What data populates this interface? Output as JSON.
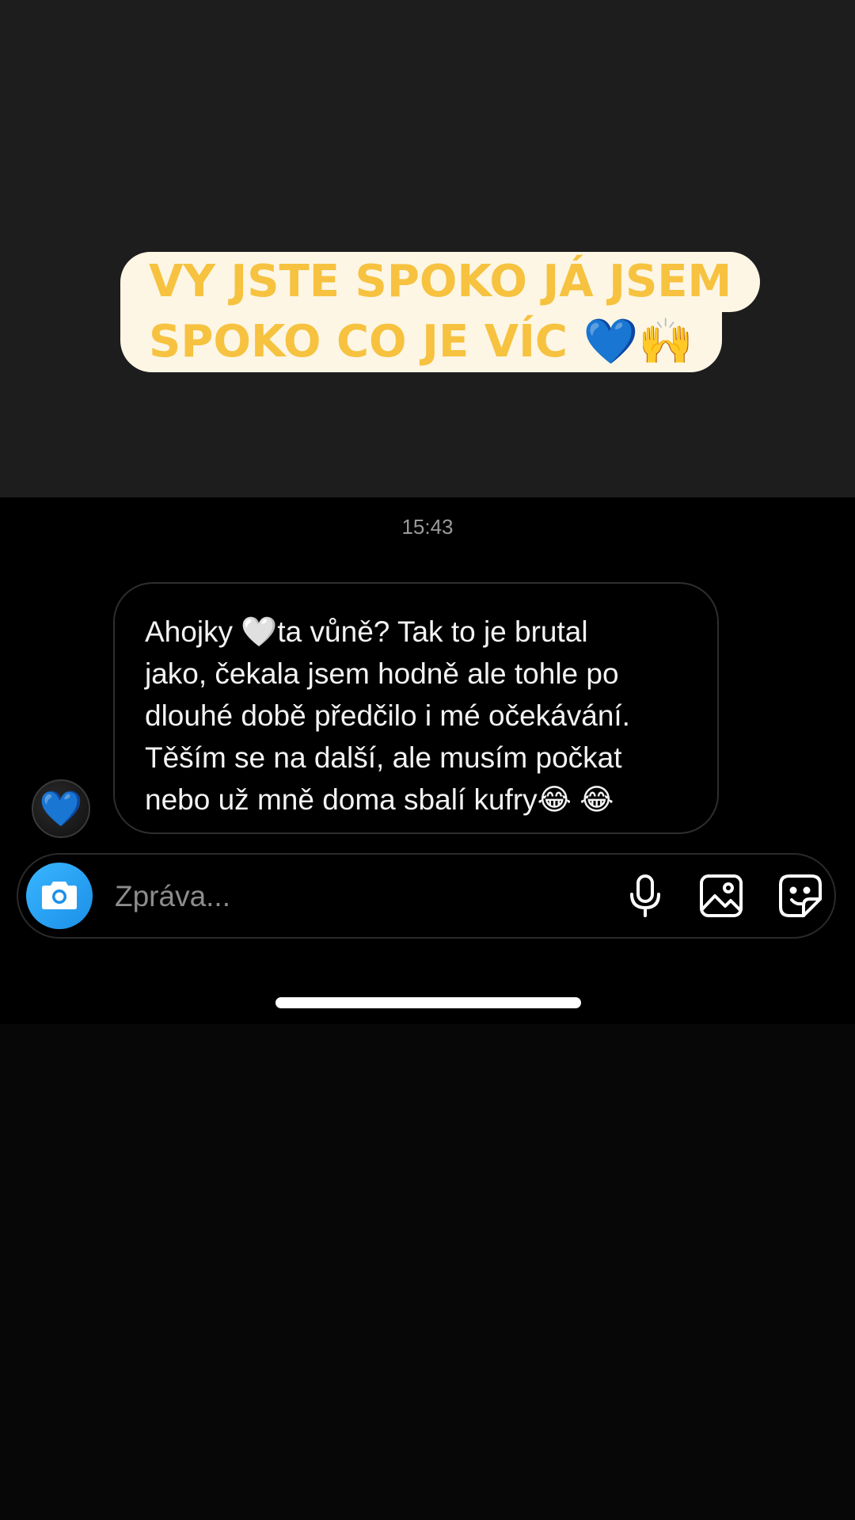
{
  "story": {
    "caption_line1": "VY JSTE SPOKO JÁ JSEM",
    "caption_line2": "SPOKO CO JE VÍC 💙🙌"
  },
  "chat": {
    "timestamp": "15:43",
    "avatar_emoji": "💙",
    "message_lines": [
      "Ahojky 🤍ta vůně? Tak to je brutal",
      "jako, čekala jsem hodně ale tohle po",
      "dlouhé době předčilo i mé očekávání.",
      "Těším se na další, ale musím počkat",
      "nebo už mně doma sbalí kufry😂 😂"
    ]
  },
  "composer": {
    "placeholder": "Zpráva...",
    "value": "",
    "icons": [
      "camera-icon",
      "microphone-icon",
      "gallery-icon",
      "sticker-icon"
    ]
  },
  "colors": {
    "story_bg": "#1d1d1e",
    "caption_bg": "#fdf6e4",
    "caption_text": "#f6c23f",
    "chat_bg": "#000000",
    "camera_button": "#1b8fe8"
  }
}
